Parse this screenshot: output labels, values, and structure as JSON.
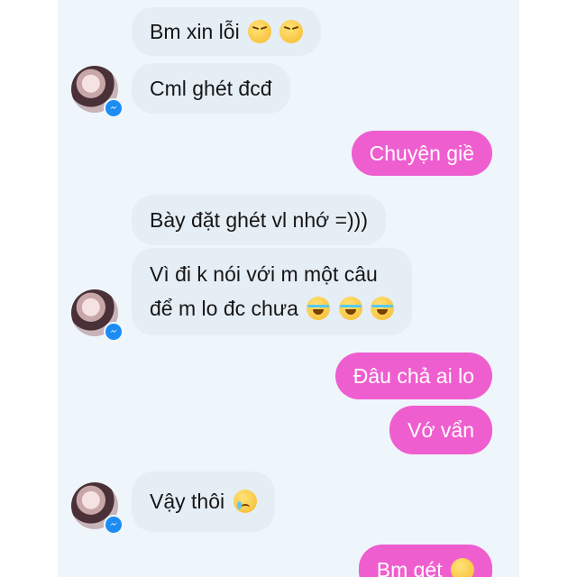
{
  "messages": [
    {
      "text": "Bm xin lỗi",
      "emoji": "angry-face-icon"
    },
    {
      "text": "Cml ghét đcđ"
    },
    {
      "text": "Chuyện giề"
    },
    {
      "text": "Bày đặt ghét vl nhớ =)))"
    },
    {
      "line1": "Vì đi k nói với m một câu",
      "line2": "để m lo đc chưa",
      "emoji": "laughing-face-icon"
    },
    {
      "text": "Đâu chả ai lo"
    },
    {
      "text": "Vớ vẩn"
    },
    {
      "text": "Vậy thôi",
      "emoji": "crying-face-icon"
    },
    {
      "text": "Bm gét"
    }
  ],
  "colors": {
    "outgoing_bubble": "#ef5ecf",
    "incoming_bubble": "#e6eef5",
    "messenger_badge": "#1d8cf2"
  }
}
